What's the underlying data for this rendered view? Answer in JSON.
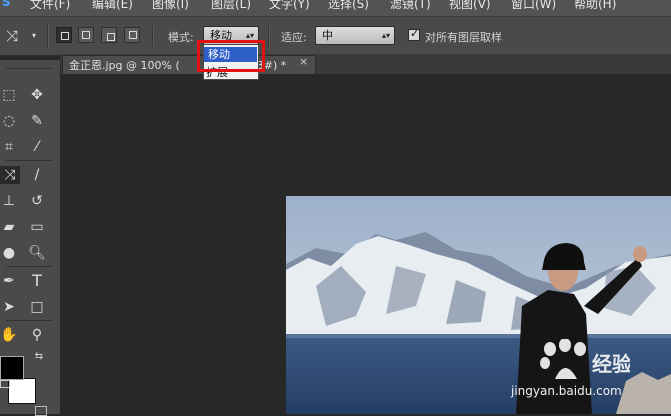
{
  "menu": {
    "items": [
      "S",
      "文件(F)",
      "编辑(E)",
      "图像(I)",
      "图层(L)",
      "文字(Y)",
      "选择(S)",
      "滤镜(T)",
      "视图(V)",
      "窗口(W)",
      "帮助(H)"
    ]
  },
  "options_bar": {
    "mode_label": "模式:",
    "mode_value": "移动",
    "adapt_label": "适应:",
    "adapt_value": "中",
    "sample_all_layers_label": "对所有图层取样",
    "sample_all_layers_checked": true
  },
  "document_tab": {
    "label": "金正恩.jpg @ 100% (",
    "label_tail": "3#) *",
    "close": "×"
  },
  "mode_dropdown": {
    "options": [
      "移动",
      "扩展"
    ],
    "selected_index": 0
  },
  "colors": {
    "accent_highlight": "#e01212",
    "selected_option_bg": "#2e5fc9",
    "ui_panel": "#4a4a4a",
    "workspace": "#282828"
  },
  "watermark": {
    "text": "jingyan.baidu.com"
  }
}
